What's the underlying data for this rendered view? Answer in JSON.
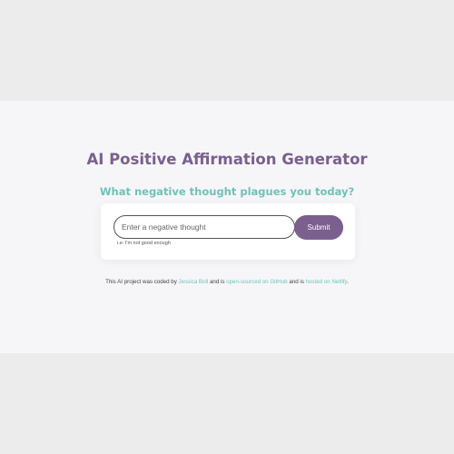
{
  "header": {
    "title": "AI Positive Affirmation Generator",
    "subtitle": "What negative thought plagues you today?"
  },
  "form": {
    "input_placeholder": "Enter a negative thought",
    "input_value": "",
    "hint": "i.e: I'm not good enough",
    "submit_label": "Submit"
  },
  "footer": {
    "text_1": "This AI project was coded by ",
    "author_link": "Jessica Boll",
    "text_2": " and is ",
    "github_link": "open-sourced on GitHub",
    "text_3": " and is ",
    "netlify_link": "hosted on Netlify",
    "text_4": "."
  },
  "colors": {
    "brand_purple": "#7a5f8f",
    "accent_teal": "#6ec3b8",
    "page_background": "#f6f6f9",
    "outer_background": "#ececec"
  }
}
